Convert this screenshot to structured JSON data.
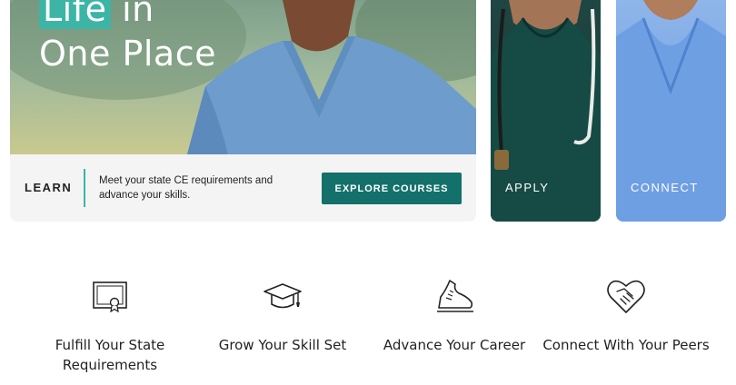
{
  "hero": {
    "title_line1_highlight": "Life",
    "title_line1_rest": "in",
    "title_line2": "One Place"
  },
  "learn": {
    "label": "LEARN",
    "description": "Meet your state CE requirements and advance your skills.",
    "button_label": "EXPLORE COURSES"
  },
  "cards": {
    "apply_label": "APPLY",
    "connect_label": "CONNECT"
  },
  "features": [
    {
      "label": "Fulfill Your State Requirements",
      "icon": "certificate-icon"
    },
    {
      "label": "Grow Your Skill Set",
      "icon": "graduation-cap-icon"
    },
    {
      "label": "Advance Your Career",
      "icon": "running-shoe-icon"
    },
    {
      "label": "Connect With Your Peers",
      "icon": "heart-handshake-icon"
    }
  ],
  "colors": {
    "accent_teal": "#3cb5a6",
    "button_dark_teal": "#14706a",
    "apply_card": "#0f3833",
    "connect_card": "#6a9de1"
  }
}
